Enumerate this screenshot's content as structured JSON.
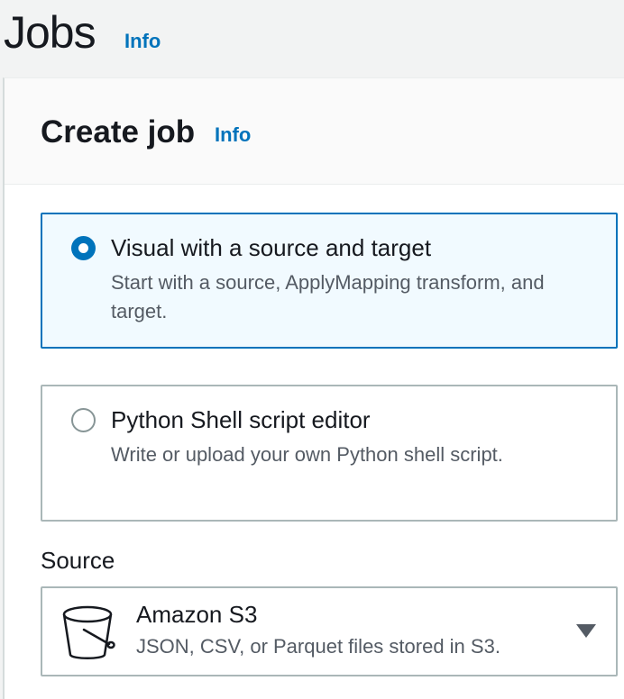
{
  "header": {
    "title": "Jobs",
    "info": "Info"
  },
  "create_job": {
    "title": "Create job",
    "info": "Info",
    "options": [
      {
        "label": "Visual with a source and target",
        "description": "Start with a source, ApplyMapping transform, and target.",
        "selected": true
      },
      {
        "label": "Python Shell script editor",
        "description": "Write or upload your own Python shell script.",
        "selected": false
      }
    ],
    "source": {
      "label": "Source",
      "selected": {
        "icon": "bucket-icon",
        "label": "Amazon S3",
        "description": "JSON, CSV, or Parquet files stored in S3."
      },
      "dropdown_icon": "caret-down-icon"
    }
  },
  "colors": {
    "link": "#0073bb",
    "selected_border": "#0073bb",
    "selected_background": "#f1faff",
    "text_primary": "#16191f",
    "text_secondary": "#545b64"
  }
}
